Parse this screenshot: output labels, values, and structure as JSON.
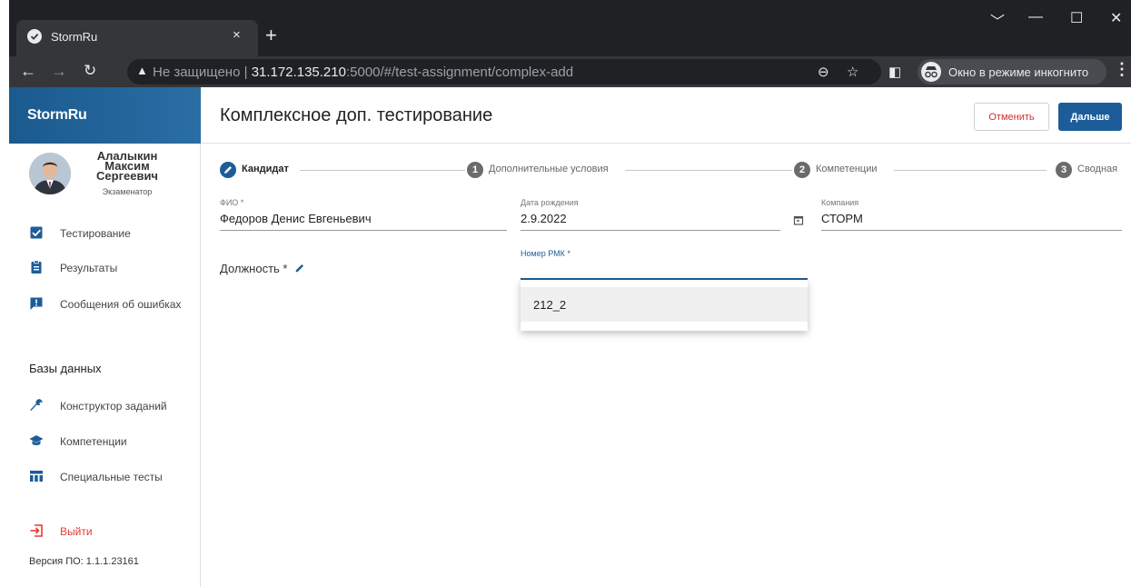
{
  "browser": {
    "tab_title": "StormRu",
    "tab_close": "×",
    "new_tab": "+",
    "minimize": "—",
    "maximize": "☐",
    "close": "✕",
    "chevron": "﹀",
    "not_secure": "Не защищено",
    "url_host": "31.172.135.210",
    "url_rest": ":5000/#/test-assignment/complex-add",
    "incognito_label": "Окно в режиме инкогнито"
  },
  "sidebar": {
    "brand": "StormRu",
    "user_name": "Алалыкин Максим Сергеевич",
    "user_role": "Экзаменатор",
    "items": [
      {
        "label": "Тестирование",
        "icon": "checkbox-icon"
      },
      {
        "label": "Результаты",
        "icon": "clipboard-icon"
      },
      {
        "label": "Сообщения об ошибках",
        "icon": "report-icon"
      }
    ],
    "section_title": "Базы данных",
    "db_items": [
      {
        "label": "Конструктор заданий",
        "icon": "wrench-icon"
      },
      {
        "label": "Компетенции",
        "icon": "school-icon"
      },
      {
        "label": "Специальные тесты",
        "icon": "table-icon"
      }
    ],
    "logout": "Выйти",
    "version": "Версия ПО: 1.1.1.23161"
  },
  "header": {
    "title": "Комплексное доп. тестирование",
    "cancel": "Отменить",
    "next": "Дальше"
  },
  "stepper": {
    "steps": [
      {
        "label": "Кандидат",
        "number": ""
      },
      {
        "label": "Дополнительные условия",
        "number": "1"
      },
      {
        "label": "Компетенции",
        "number": "2"
      },
      {
        "label": "Сводная",
        "number": "3"
      }
    ]
  },
  "form": {
    "fio_label": "ФИО *",
    "fio_value": "Федоров Денис Евгеньевич",
    "dob_label": "Дата рождения",
    "dob_value": "2.9.2022",
    "company_label": "Компания",
    "company_value": "СТОРМ",
    "position_label": "Должность *",
    "rmk_label": "Номер РМК *",
    "rmk_options": [
      "212_2"
    ]
  },
  "colors": {
    "accent": "#1c5d99",
    "danger": "#d32f2f"
  }
}
